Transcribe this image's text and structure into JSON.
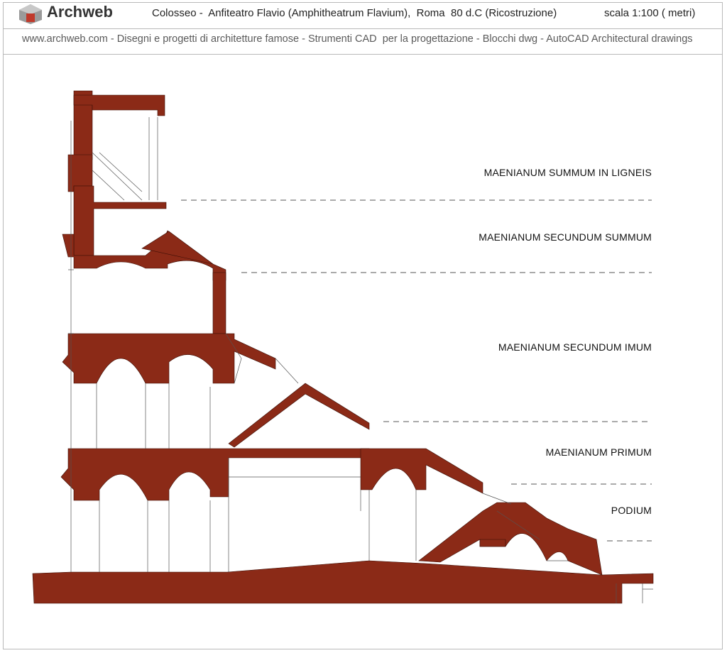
{
  "header": {
    "brand": "Archweb",
    "title": "Colosseo -  Anfiteatro Flavio (Amphitheatrum Flavium),  Roma  80 d.C (Ricostruzione)",
    "scale": "scala 1:100 ( metri)"
  },
  "subheader": "www.archweb.com - Disegni e progetti di architetture famose - Strumenti CAD  per la progettazione - Blocchi dwg - AutoCAD Architectural drawings",
  "levels": [
    {
      "name": "MAENIANUM SUMMUM IN LIGNEIS"
    },
    {
      "name": "MAENIANUM SECUNDUM SUMMUM"
    },
    {
      "name": "MAENIANUM SECUNDUM IMUM"
    },
    {
      "name": "MAENIANUM PRIMUM"
    },
    {
      "name": "PODIUM"
    }
  ],
  "colors": {
    "section_fill": "#8b2a17",
    "logo_red": "#c0392b",
    "logo_grey": "#8c8c8c"
  }
}
